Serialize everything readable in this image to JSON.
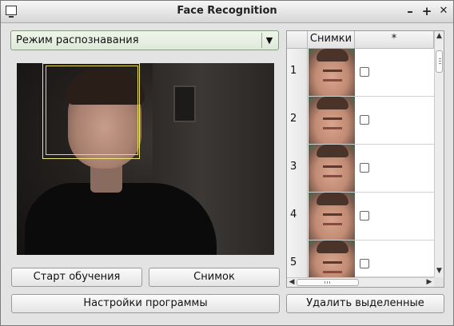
{
  "window": {
    "title": "Face Recognition",
    "controls": {
      "minimize": "–",
      "maximize": "+",
      "close": "✕"
    }
  },
  "mode_select": {
    "selected": "Режим распознавания"
  },
  "table": {
    "headers": [
      "Снимки",
      "*"
    ],
    "rows": [
      {
        "index": "1",
        "checked": false
      },
      {
        "index": "2",
        "checked": false
      },
      {
        "index": "3",
        "checked": false
      },
      {
        "index": "4",
        "checked": false
      },
      {
        "index": "5",
        "checked": false
      }
    ]
  },
  "buttons": {
    "start_training": "Старт обучения",
    "snapshot": "Снимок",
    "settings": "Настройки программы",
    "delete_selected": "Удалить выделенные"
  },
  "icons": {
    "dropdown": "chevron-down-icon",
    "scroll_up": "arrow-up-icon",
    "scroll_down": "arrow-down-icon",
    "scroll_left": "arrow-left-icon",
    "scroll_right": "arrow-right-icon"
  }
}
